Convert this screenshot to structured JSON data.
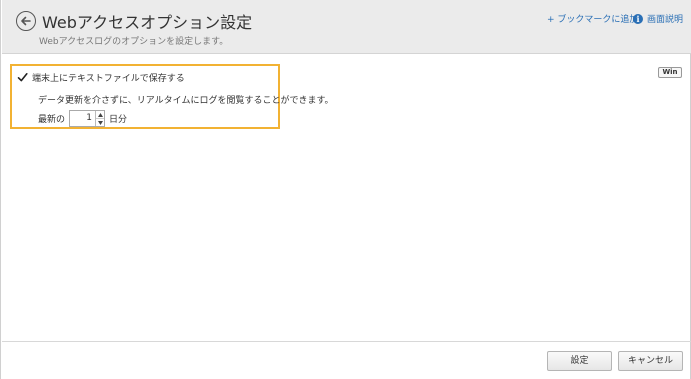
{
  "header": {
    "title": "Webアクセスオプション設定",
    "subtitle": "Webアクセスログのオプションを設定します。",
    "bookmark_link": "+ ブックマークに追加",
    "help_link": "画面説明",
    "help_icon": "info-icon"
  },
  "option": {
    "checkbox_label": "端末上にテキストファイルで保存する",
    "checked": true,
    "description": "データ更新を介さずに、リアルタイムにログを閲覧することができます。",
    "recent_prefix": "最新の",
    "days_value": "1",
    "recent_suffix": "日分"
  },
  "badge": {
    "os": "Win"
  },
  "footer": {
    "set_label": "設定",
    "cancel_label": "キャンセル"
  },
  "colors": {
    "highlight_border": "#f2b233",
    "link": "#2a6fb5",
    "header_bg": "#ebebeb"
  }
}
